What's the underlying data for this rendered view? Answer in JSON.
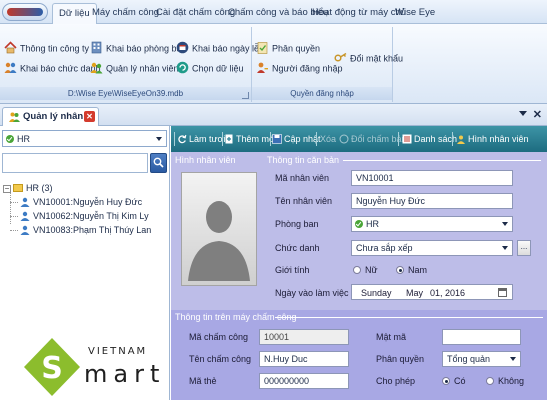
{
  "menu": {
    "tabs": [
      "Dữ liệu",
      "Máy chấm công",
      "Cài đặt chấm công",
      "Chấm công và báo biểu",
      "Hoạt động từ máy chủ",
      "Wise Eye"
    ],
    "active_tab": "Dữ liệu"
  },
  "ribbon": {
    "data_group": {
      "path_label": "D:\\Wise Eye\\WiseEyeOn39.mdb",
      "buttons": {
        "company_info": "Thông tin công ty",
        "position_setup": "Khai báo chức danh",
        "department_setup": "Khai báo phòng ban",
        "employee_management": "Quản lý nhân viên",
        "holiday_setup": "Khai báo ngày lễ",
        "select_data": "Chọn dữ liệu"
      }
    },
    "login_group": {
      "label": "Quyền đăng nhập",
      "buttons": {
        "permission": "Phân quyền",
        "login_user": "Người đăng nhập",
        "change_password": "Đổi mật khẩu"
      }
    }
  },
  "doc_tab": {
    "label": "Quản lý nhân viên"
  },
  "left_panel": {
    "department_value": "HR",
    "tree": {
      "root": "HR (3)",
      "employees": [
        "VN10001:Nguyễn Huy Đức",
        "VN10062:Nguyễn Thị Kim Ly",
        "VN10083:Phạm Thị Thúy Lan"
      ]
    }
  },
  "toolbar": {
    "refresh": "Làm tươi",
    "add": "Thêm mới",
    "update": "Cập nhật",
    "delete": "Xóa",
    "change_code": "Đổi chấm bản",
    "list": "Danh sách",
    "photo": "Hình nhân viên"
  },
  "form": {
    "photo_section": "Hình nhân viên",
    "basic_section": "Thông tin căn bản",
    "labels": {
      "emp_code": "Mã nhân viên",
      "emp_name": "Tên nhân viên",
      "department": "Phòng ban",
      "position": "Chức danh",
      "gender": "Giới tính",
      "start_date": "Ngày vào làm việc"
    },
    "values": {
      "emp_code": "VN10001",
      "emp_name": "Nguyễn Huy Đức",
      "department": "HR",
      "position": "Chưa sắp xếp"
    },
    "gender_options": {
      "female": "Nữ",
      "male": "Nam"
    },
    "gender_selected": "Nam",
    "date": {
      "weekday": "Sunday",
      "month": "May",
      "day_year": "01, 2016"
    },
    "ellipsis": "..."
  },
  "machine_info": {
    "section": "Thông tin trên máy chấm công",
    "labels": {
      "machine_code": "Mã chấm công",
      "machine_name": "Tên chấm công",
      "card_code": "Mã thẻ",
      "password": "Mật mã",
      "privilege": "Phân quyền",
      "allow": "Cho phép"
    },
    "values": {
      "machine_code": "10001",
      "machine_name": "N.Huy Duc",
      "card_code": "000000000",
      "password": "",
      "privilege": "Tổng quản"
    },
    "allow_options": {
      "yes": "Có",
      "no": "Không"
    },
    "allow_selected": "Có"
  },
  "watermark": {
    "line1": "VIETNAM",
    "line2": "mart"
  },
  "colors": {
    "accent_teal": "#2a7f93",
    "form_background": "#bdbde8",
    "ribbon_background": "#dbe7f6",
    "watermark_green": "#8cbd2d"
  }
}
